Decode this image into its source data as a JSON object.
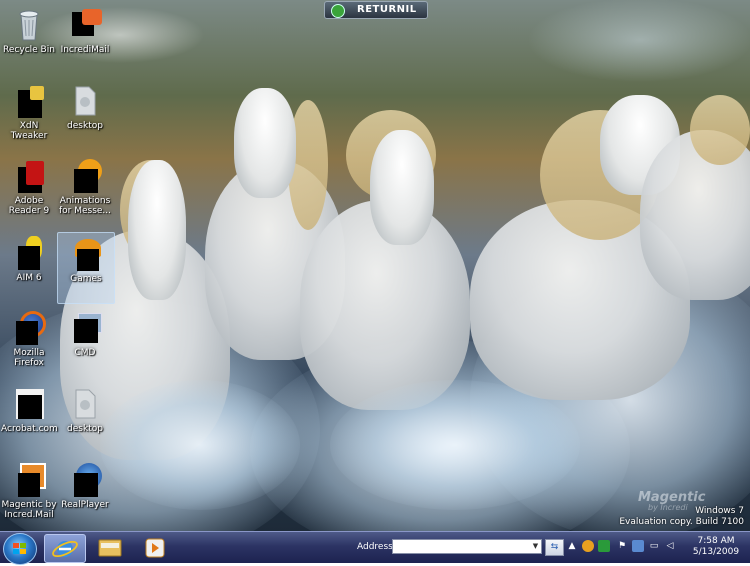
{
  "returnil": {
    "label": "RETURNIL"
  },
  "desktop_icons": [
    {
      "label": "Recycle Bin",
      "icon": "recycle-bin-icon"
    },
    {
      "label": "IncrediMail",
      "icon": "incredimail-icon"
    },
    {
      "label": "XdN Tweaker",
      "icon": "xdn-tweaker-icon"
    },
    {
      "label": "desktop",
      "icon": "file-icon"
    },
    {
      "label": "Adobe Reader 9",
      "icon": "adobe-reader-icon"
    },
    {
      "label": "Animations for Messe...",
      "icon": "animations-icon"
    },
    {
      "label": "AIM 6",
      "icon": "aim-icon"
    },
    {
      "label": "Games",
      "icon": "games-icon"
    },
    {
      "label": "Mozilla Firefox",
      "icon": "firefox-icon"
    },
    {
      "label": "CMD",
      "icon": "cmd-icon"
    },
    {
      "label": "Acrobat.com",
      "icon": "acrobat-icon"
    },
    {
      "label": "desktop",
      "icon": "file-icon"
    },
    {
      "label": "Magentic by Incred.Mail",
      "icon": "magentic-icon"
    },
    {
      "label": "RealPlayer",
      "icon": "realplayer-icon"
    }
  ],
  "watermark": {
    "line1": "Windows 7",
    "line2": "Evaluation copy. Build 7100",
    "brand": "Magentic",
    "brand_sub": "by Incredi"
  },
  "taskbar": {
    "address_label": "Address",
    "address_value": "",
    "go_icon": "go-arrow-icon",
    "time": "7:58 AM",
    "date": "5/13/2009",
    "pinned": [
      {
        "name": "internet-explorer-icon",
        "active": true
      },
      {
        "name": "windows-explorer-icon",
        "active": false
      },
      {
        "name": "media-player-icon",
        "active": false
      }
    ]
  }
}
